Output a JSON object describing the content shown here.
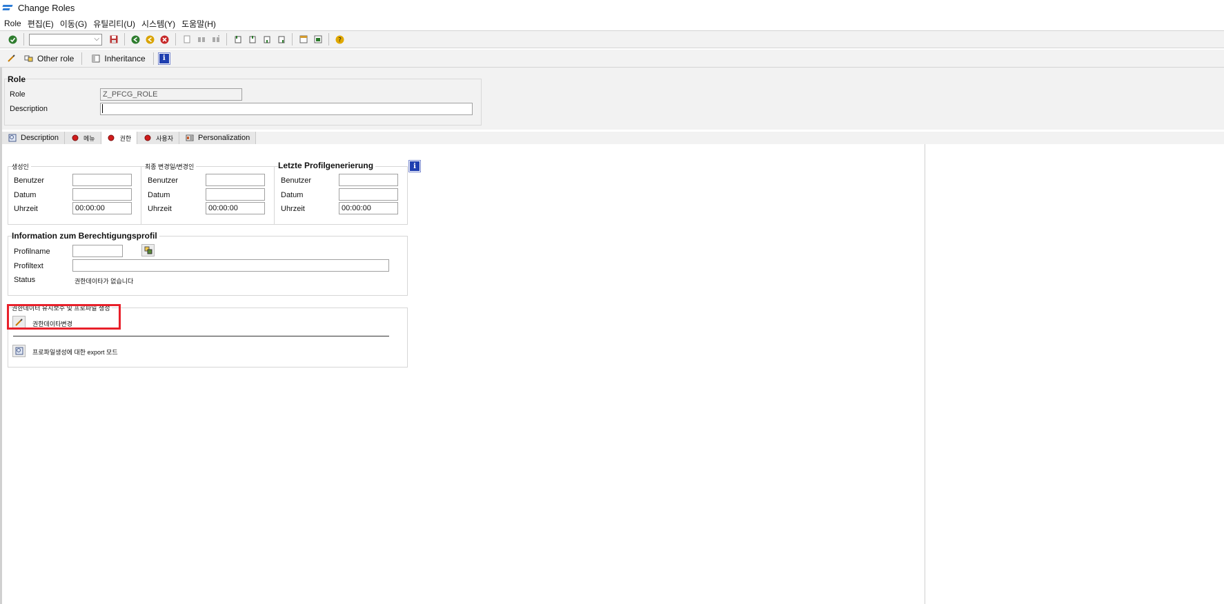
{
  "window": {
    "title": "Change Roles"
  },
  "menu": [
    "Role",
    "편집(E)",
    "이동(G)",
    "유틸리티(U)",
    "시스템(Y)",
    "도움말(H)"
  ],
  "toolbar": {
    "icons": [
      "enter-icon",
      "command-field",
      "save-icon",
      "back-icon",
      "exit-icon",
      "cancel-icon",
      "print-icon",
      "find-icon",
      "find-next-icon",
      "first-page-icon",
      "prev-page-icon",
      "next-page-icon",
      "last-page-icon",
      "new-session-icon",
      "shortcut-icon",
      "help-icon"
    ]
  },
  "app_toolbar": {
    "other_role": "Other role",
    "inheritance": "Inheritance",
    "info": "i"
  },
  "role_group": {
    "title": "Role",
    "role_label": "Role",
    "role_value": "Z_PFCG_ROLE",
    "description_label": "Description",
    "description_value": ""
  },
  "tabs": [
    {
      "label": "Description"
    },
    {
      "label": "메뉴"
    },
    {
      "label": "권한"
    },
    {
      "label": "사용자"
    },
    {
      "label": "Personalization"
    }
  ],
  "created_by": {
    "title": "생성인",
    "user_label": "Benutzer",
    "date_label": "Datum",
    "time_label": "Uhrzeit",
    "user_value": "",
    "date_value": "",
    "time_value": "00:00:00"
  },
  "last_changed": {
    "title": "최종 변경일/변경인",
    "user_label": "Benutzer",
    "date_label": "Datum",
    "time_label": "Uhrzeit",
    "user_value": "",
    "date_value": "",
    "time_value": "00:00:00"
  },
  "last_profile_gen": {
    "title": "Letzte Profilgenerierung",
    "user_label": "Benutzer",
    "date_label": "Datum",
    "time_label": "Uhrzeit",
    "user_value": "",
    "date_value": "",
    "time_value": "00:00:00"
  },
  "profile_info": {
    "title": "Information zum Berechtigungsprofil",
    "profile_name_label": "Profilname",
    "profile_name_value": "",
    "profile_text_label": "Profiltext",
    "profile_text_value": "",
    "status_label": "Status",
    "status_value": "권한데이타가 없습니다"
  },
  "auth_maintenance": {
    "title": "권한데이터 유지보수 및 프로파일 생성",
    "change_auth_label": "권한데이타변경",
    "export_mode_label": "프로파일생성에 대한 export 모드"
  }
}
